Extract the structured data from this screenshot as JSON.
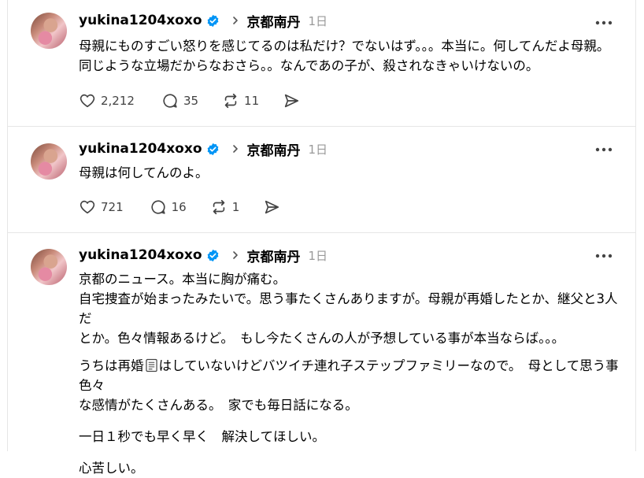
{
  "posts": [
    {
      "username": "yukina1204xoxo",
      "topic": "京都南丹",
      "time": "1日",
      "lines": [
        "母親にものすごい怒りを感じてるのは私だけ？でないはず。。。本当に。何してんだよ母親。",
        "同じような立場だからなおさら。。なんであの子が、殺されなきゃいけないの。"
      ],
      "likes": "2,212",
      "replies": "35",
      "reposts": "11"
    },
    {
      "username": "yukina1204xoxo",
      "topic": "京都南丹",
      "time": "1日",
      "lines": [
        "母親は何してんのよ。"
      ],
      "likes": "721",
      "replies": "16",
      "reposts": "1"
    },
    {
      "username": "yukina1204xoxo",
      "topic": "京都南丹",
      "time": "1日",
      "para1_line1": "京都のニュース。本当に胸が痛む。",
      "para1_line2": "自宅捜査が始まったみたいで。思う事たくさんありますが。母親が再婚したとか、継父と3人だ",
      "para1_line3": "とか。色々情報あるけど。　もし今たくさんの人が予想している事が本当ならば。。。",
      "para2_part1": "うちは再婚",
      "para2_part2": "はしていないけどバツイチ連れ子ステップファミリーなので。　母として思う事色々",
      "para2_line2": "な感情がたくさんある。　家でも毎日話になる。",
      "para3": "一日１秒でも早く早く　解決してほしい。",
      "para4": "心苦しい。"
    }
  ],
  "colors": {
    "verified": "#0095f6",
    "muted": "#999999",
    "separator": "#e6e6e6"
  }
}
